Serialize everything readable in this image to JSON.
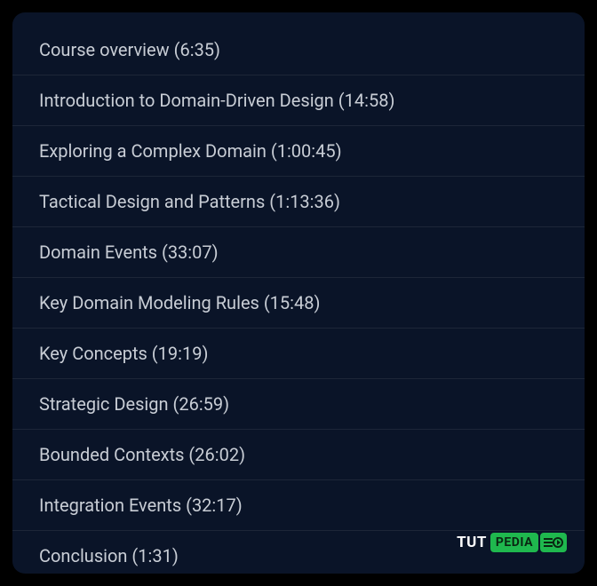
{
  "lessons": [
    {
      "label": "Course overview (6:35)"
    },
    {
      "label": "Introduction to Domain-Driven Design (14:58)"
    },
    {
      "label": "Exploring a Complex Domain (1:00:45)"
    },
    {
      "label": "Tactical Design and Patterns (1:13:36)"
    },
    {
      "label": "Domain Events (33:07)"
    },
    {
      "label": "Key Domain Modeling Rules (15:48)"
    },
    {
      "label": "Key Concepts (19:19)"
    },
    {
      "label": "Strategic Design (26:59)"
    },
    {
      "label": "Bounded Contexts (26:02)"
    },
    {
      "label": "Integration Events (32:17)"
    },
    {
      "label": "Conclusion (1:31)"
    }
  ],
  "watermark": {
    "tut": "TUT",
    "pedia": "PEDIA"
  }
}
